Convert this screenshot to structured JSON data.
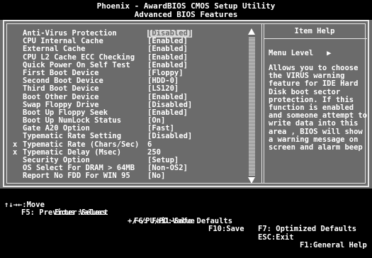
{
  "header": {
    "line1": "Phoenix - AwardBIOS CMOS Setup Utility",
    "line2": "Advanced BIOS Features"
  },
  "settings": [
    {
      "marker": "",
      "label": "Anti-Virus Protection",
      "value": "[Disabled]",
      "selected": true
    },
    {
      "marker": "",
      "label": "CPU Internal Cache",
      "value": "[Enabled]"
    },
    {
      "marker": "",
      "label": "External Cache",
      "value": "[Enabled]"
    },
    {
      "marker": "",
      "label": "CPU L2 Cache ECC Checking",
      "value": "[Enabled]"
    },
    {
      "marker": "",
      "label": "Quick Power On Self Test",
      "value": "[Enabled]"
    },
    {
      "marker": "",
      "label": "First Boot Device",
      "value": "[Floppy]"
    },
    {
      "marker": "",
      "label": "Second Boot Device",
      "value": "[HDD-0]"
    },
    {
      "marker": "",
      "label": "Third Boot Device",
      "value": "[LS120]"
    },
    {
      "marker": "",
      "label": "Boot Other Device",
      "value": "[Enabled]"
    },
    {
      "marker": "",
      "label": "Swap Floppy Drive",
      "value": "[Disabled]"
    },
    {
      "marker": "",
      "label": "Boot Up Floppy Seek",
      "value": "[Enabled]"
    },
    {
      "marker": "",
      "label": "Boot Up NumLock Status",
      "value": "[On]"
    },
    {
      "marker": "",
      "label": "Gate A20 Option",
      "value": "[Fast]"
    },
    {
      "marker": "",
      "label": "Typematic Rate Setting",
      "value": "[Disabled]"
    },
    {
      "marker": "x",
      "label": "Typematic Rate (Chars/Sec)",
      "value": "6"
    },
    {
      "marker": "x",
      "label": "Typematic Delay (Msec)",
      "value": "250"
    },
    {
      "marker": "",
      "label": "Security Option",
      "value": "[Setup]"
    },
    {
      "marker": "",
      "label": "OS Select For DRAM > 64MB",
      "value": "[Non-OS2]"
    },
    {
      "marker": "",
      "label": "Report No FDD For WIN 95",
      "value": "[No]"
    }
  ],
  "help": {
    "title": "Item Help",
    "menu_level": "Menu Level   ▶",
    "text": "Allows you to choose\nthe VIRUS warning\nfeature for IDE Hard\nDisk boot sector\nprotection. If this\nfunction is enabled\nand someone attempt to\nwrite data into this\narea , BIOS will show\na warning message on\nscreen and alarm beep"
  },
  "footer": {
    "move": "↑↓→←:Move",
    "select": "Enter:Select",
    "value": "+/-/PU/PD:Value",
    "save": "F10:Save",
    "exit": "ESC:Exit",
    "general_help": "F1:General Help",
    "prev_values": "F5: Previous Values",
    "fail_safe": "F6: Fail-Safe Defaults",
    "optimized": "F7: Optimized Defaults"
  },
  "colors": {
    "background": "#6b6b6b",
    "header_bg": "#000000",
    "text": "#ffffff"
  }
}
